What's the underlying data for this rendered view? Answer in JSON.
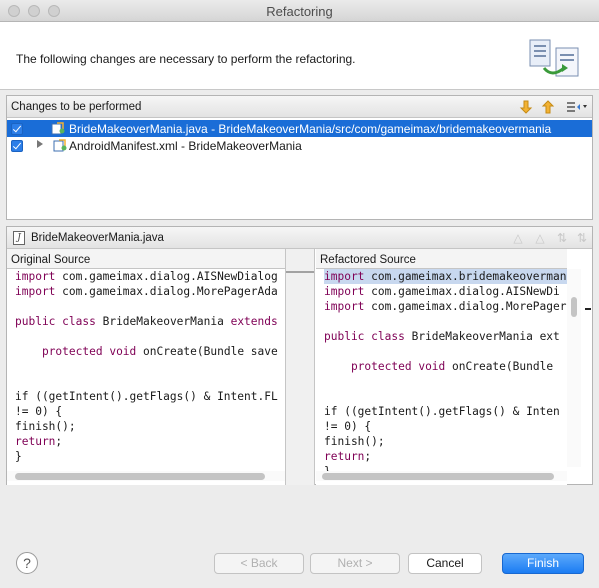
{
  "window": {
    "title": "Refactoring"
  },
  "header": {
    "message": "The following changes are necessary to perform the refactoring."
  },
  "changes": {
    "title": "Changes to be performed",
    "items": [
      {
        "label": "BrideMakeoverMania.java - BrideMakeoverMania/src/com/gameimax/bridemakeovermania",
        "checked": true,
        "selected": true
      },
      {
        "label": "AndroidManifest.xml - BrideMakeoverMania",
        "checked": true,
        "selected": false
      }
    ]
  },
  "compare": {
    "file": "BrideMakeoverMania.java",
    "original_title": "Original Source",
    "refactored_title": "Refactored Source",
    "original_lines": [
      "import com.gameimax.dialog.AISNewDialog",
      "import com.gameimax.dialog.MorePagerAda",
      "",
      "public class BrideMakeoverMania extends",
      "",
      "    protected void onCreate(Bundle save",
      "",
      "",
      "if ((getIntent().getFlags() & Intent.FL",
      "!= 0) {",
      "finish();",
      "return;",
      "}"
    ],
    "refactored_lines": [
      "import com.gameimax.bridemakeovermania",
      "import com.gameimax.dialog.AISNewDi",
      "import com.gameimax.dialog.MorePager",
      "",
      "public class BrideMakeoverMania ext",
      "",
      "    protected void onCreate(Bundle",
      "",
      "",
      "if ((getIntent().getFlags() & Inten",
      "!= 0) {",
      "finish();",
      "return;",
      "}"
    ]
  },
  "buttons": {
    "help": "?",
    "back": "< Back",
    "next": "Next >",
    "cancel": "Cancel",
    "finish": "Finish"
  }
}
